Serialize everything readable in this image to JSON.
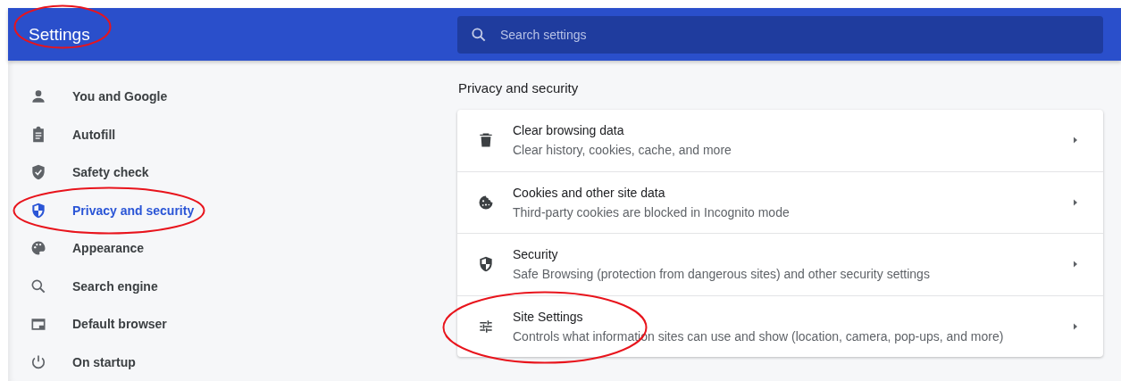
{
  "header": {
    "title": "Settings",
    "circled": true,
    "search": {
      "placeholder": "Search settings"
    }
  },
  "sidebar": {
    "items": [
      {
        "label": "You and Google",
        "kind": "person",
        "selected": false,
        "circled": false
      },
      {
        "label": "Autofill",
        "kind": "clipboard",
        "selected": false,
        "circled": false
      },
      {
        "label": "Safety check",
        "kind": "shield-check",
        "selected": false,
        "circled": false
      },
      {
        "label": "Privacy and security",
        "kind": "shield",
        "selected": true,
        "circled": true
      },
      {
        "label": "Appearance",
        "kind": "palette",
        "selected": false,
        "circled": false
      },
      {
        "label": "Search engine",
        "kind": "search",
        "selected": false,
        "circled": false
      },
      {
        "label": "Default browser",
        "kind": "browser",
        "selected": false,
        "circled": false
      },
      {
        "label": "On startup",
        "kind": "power",
        "selected": false,
        "circled": false
      }
    ]
  },
  "section": {
    "title": "Privacy and security",
    "rows": [
      {
        "title": "Clear browsing data",
        "subtitle": "Clear history, cookies, cache, and more",
        "kind": "trash",
        "circled": false
      },
      {
        "title": "Cookies and other site data",
        "subtitle": "Third-party cookies are blocked in Incognito mode",
        "kind": "cookie",
        "circled": false
      },
      {
        "title": "Security",
        "subtitle": "Safe Browsing (protection from dangerous sites) and other security settings",
        "kind": "shield",
        "circled": false
      },
      {
        "title": "Site Settings",
        "subtitle": "Controls what information sites can use and show (location, camera, pop-ups, and more)",
        "kind": "sliders",
        "circled": true
      }
    ]
  }
}
